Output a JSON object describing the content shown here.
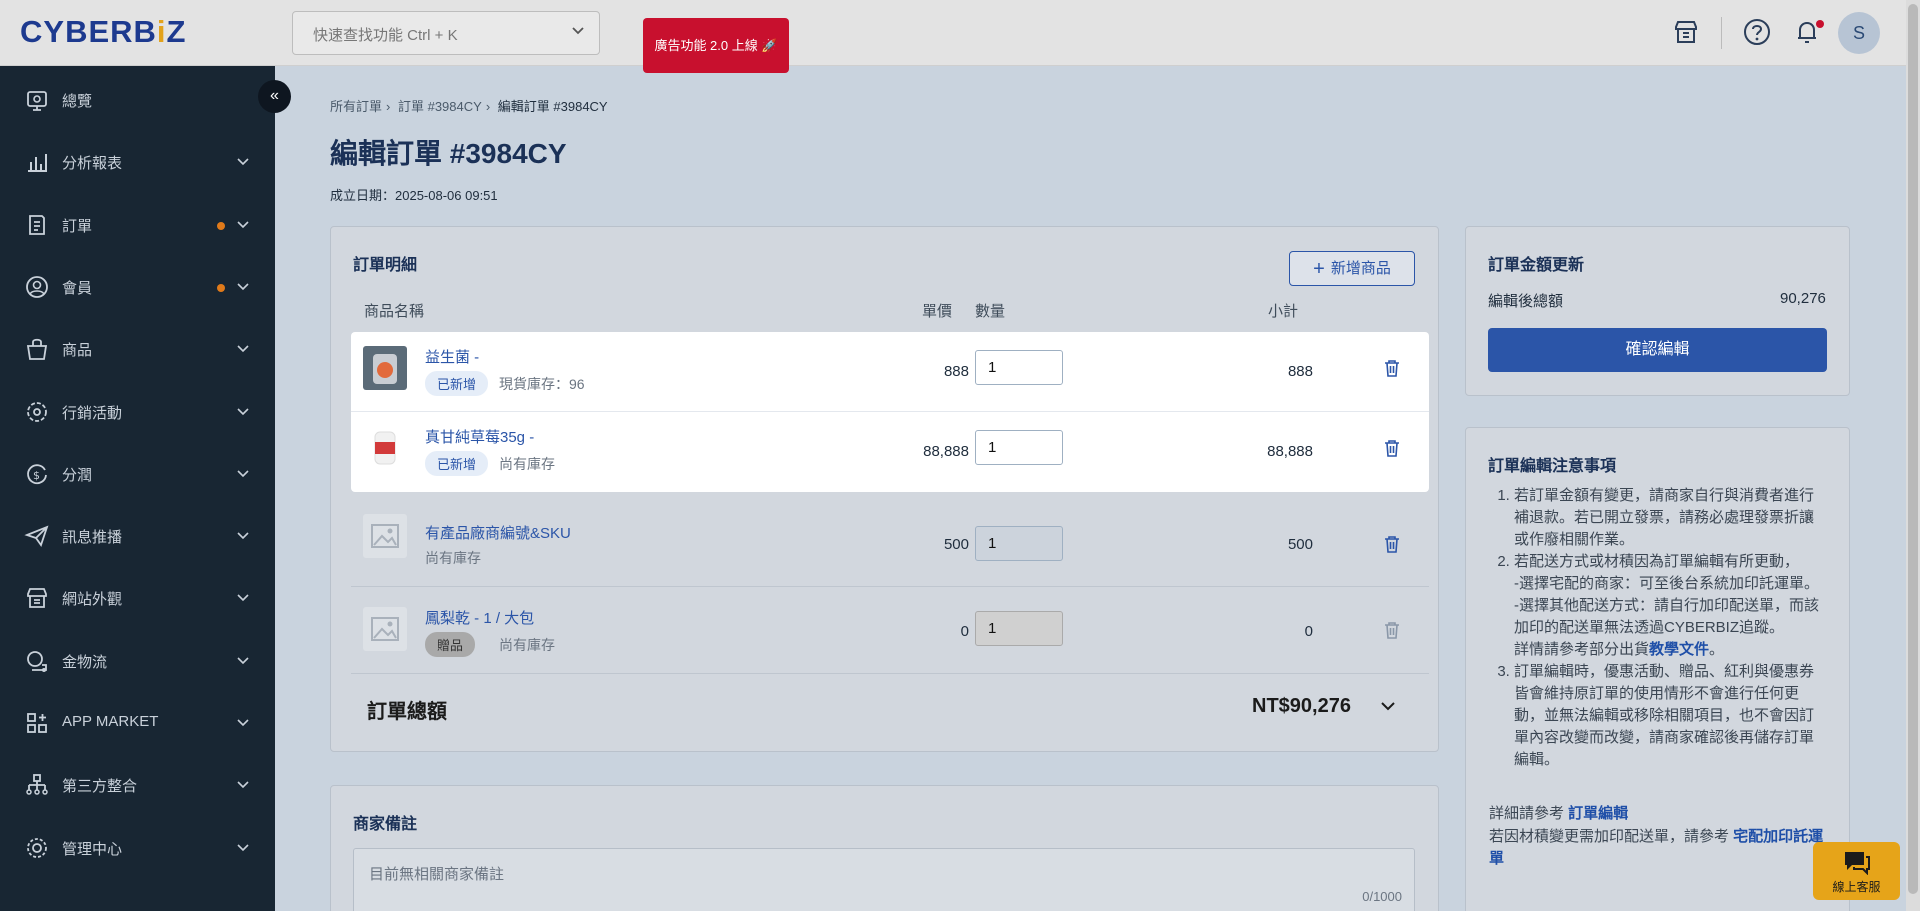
{
  "topbar": {
    "logo_left": "CYBERB",
    "logo_mid": "i",
    "logo_right": "Z",
    "search_placeholder": "快速查找功能 Ctrl + K",
    "ad_button": "廣告功能 2.0 上線 🚀",
    "avatar_initial": "S"
  },
  "sidebar": {
    "items": [
      {
        "label": "總覽",
        "icon": "dashboard-icon",
        "dot": false,
        "chevron": false
      },
      {
        "label": "分析報表",
        "icon": "chart-icon",
        "dot": false,
        "chevron": true
      },
      {
        "label": "訂單",
        "icon": "order-icon",
        "dot": true,
        "chevron": true
      },
      {
        "label": "會員",
        "icon": "member-icon",
        "dot": true,
        "chevron": true
      },
      {
        "label": "商品",
        "icon": "product-icon",
        "dot": false,
        "chevron": true
      },
      {
        "label": "行銷活動",
        "icon": "marketing-icon",
        "dot": false,
        "chevron": true
      },
      {
        "label": "分潤",
        "icon": "profit-share-icon",
        "dot": false,
        "chevron": true
      },
      {
        "label": "訊息推播",
        "icon": "send-icon",
        "dot": false,
        "chevron": true
      },
      {
        "label": "網站外觀",
        "icon": "storefront-icon",
        "dot": false,
        "chevron": true
      },
      {
        "label": "金物流",
        "icon": "logistics-icon",
        "dot": false,
        "chevron": true
      },
      {
        "label": "APP MARKET",
        "icon": "app-market-icon",
        "dot": false,
        "chevron": true
      },
      {
        "label": "第三方整合",
        "icon": "integration-icon",
        "dot": false,
        "chevron": true
      },
      {
        "label": "管理中心",
        "icon": "settings-icon",
        "dot": false,
        "chevron": true
      }
    ]
  },
  "breadcrumb": [
    "所有訂單",
    "訂單 #3984CY",
    "編輯訂單 #3984CY"
  ],
  "page": {
    "title": "編輯訂單 #3984CY",
    "created": "成立日期：2025-08-06 09:51"
  },
  "order_detail": {
    "title": "訂單明細",
    "add_button": "新增商品",
    "columns": {
      "name": "商品名稱",
      "price": "單價",
      "qty": "數量",
      "subtotal": "小計"
    },
    "rows": [
      {
        "name": "益生菌 -",
        "badge": "已新增",
        "stock": "現貨庫存：96",
        "price": "888",
        "qty": "1",
        "subtotal": "888"
      },
      {
        "name": "真甘純草莓35g -",
        "badge": "已新增",
        "stock": "尚有庫存",
        "price": "88,888",
        "qty": "1",
        "subtotal": "88,888"
      },
      {
        "name": "有產品廠商編號&SKU",
        "badge": "",
        "stock": "尚有庫存",
        "price": "500",
        "qty": "1",
        "subtotal": "500"
      },
      {
        "name": "鳳梨乾 - 1 / 大包",
        "badge": "贈品",
        "stock": "尚有庫存",
        "price": "0",
        "qty": "1",
        "subtotal": "0"
      }
    ],
    "total_label": "訂單總額",
    "total_value": "NT$90,276"
  },
  "remark": {
    "title": "商家備註",
    "placeholder": "目前無相關商家備註",
    "count": "0/1000"
  },
  "update": {
    "title": "訂單金額更新",
    "label": "編輯後總額",
    "value": "90,276",
    "confirm": "確認編輯"
  },
  "notes": {
    "title": "訂單編輯注意事項",
    "item1": "若訂單金額有變更，請商家自行與消費者進行補退款。若已開立發票，請務必處理發票折讓或作廢相關作業。",
    "item2_a": "若配送方式或材積因為訂單編輯有所更動，",
    "item2_b": "-選擇宅配的商家：可至後台系統加印託運單。",
    "item2_c": "-選擇其他配送方式：請自行加印配送單，而該加印的配送單無法透過CYBERBIZ追蹤。",
    "item2_d": "詳情請參考部分出貨",
    "item2_link": "教學文件",
    "item2_end": "。",
    "item3": "訂單編輯時，優惠活動、贈品、紅利與優惠券皆會維持原訂單的使用情形不會進行任何更動，並無法編輯或移除相關項目，也不會因訂單內容改變而改變，請商家確認後再儲存訂單編輯。",
    "ref1": "詳細請參考 ",
    "ref1_link": "訂單編輯",
    "ref2": "若因材積變更需加印配送單，請參考 ",
    "ref2_link": "宅配加印託運單"
  },
  "support": {
    "label": "線上客服"
  },
  "colors": {
    "brand": "#1d3a8f",
    "accent": "#2b55a8",
    "alert": "#c8102e",
    "sidebar": "#182633",
    "dot": "#e07a1a",
    "support": "#e6a419"
  }
}
